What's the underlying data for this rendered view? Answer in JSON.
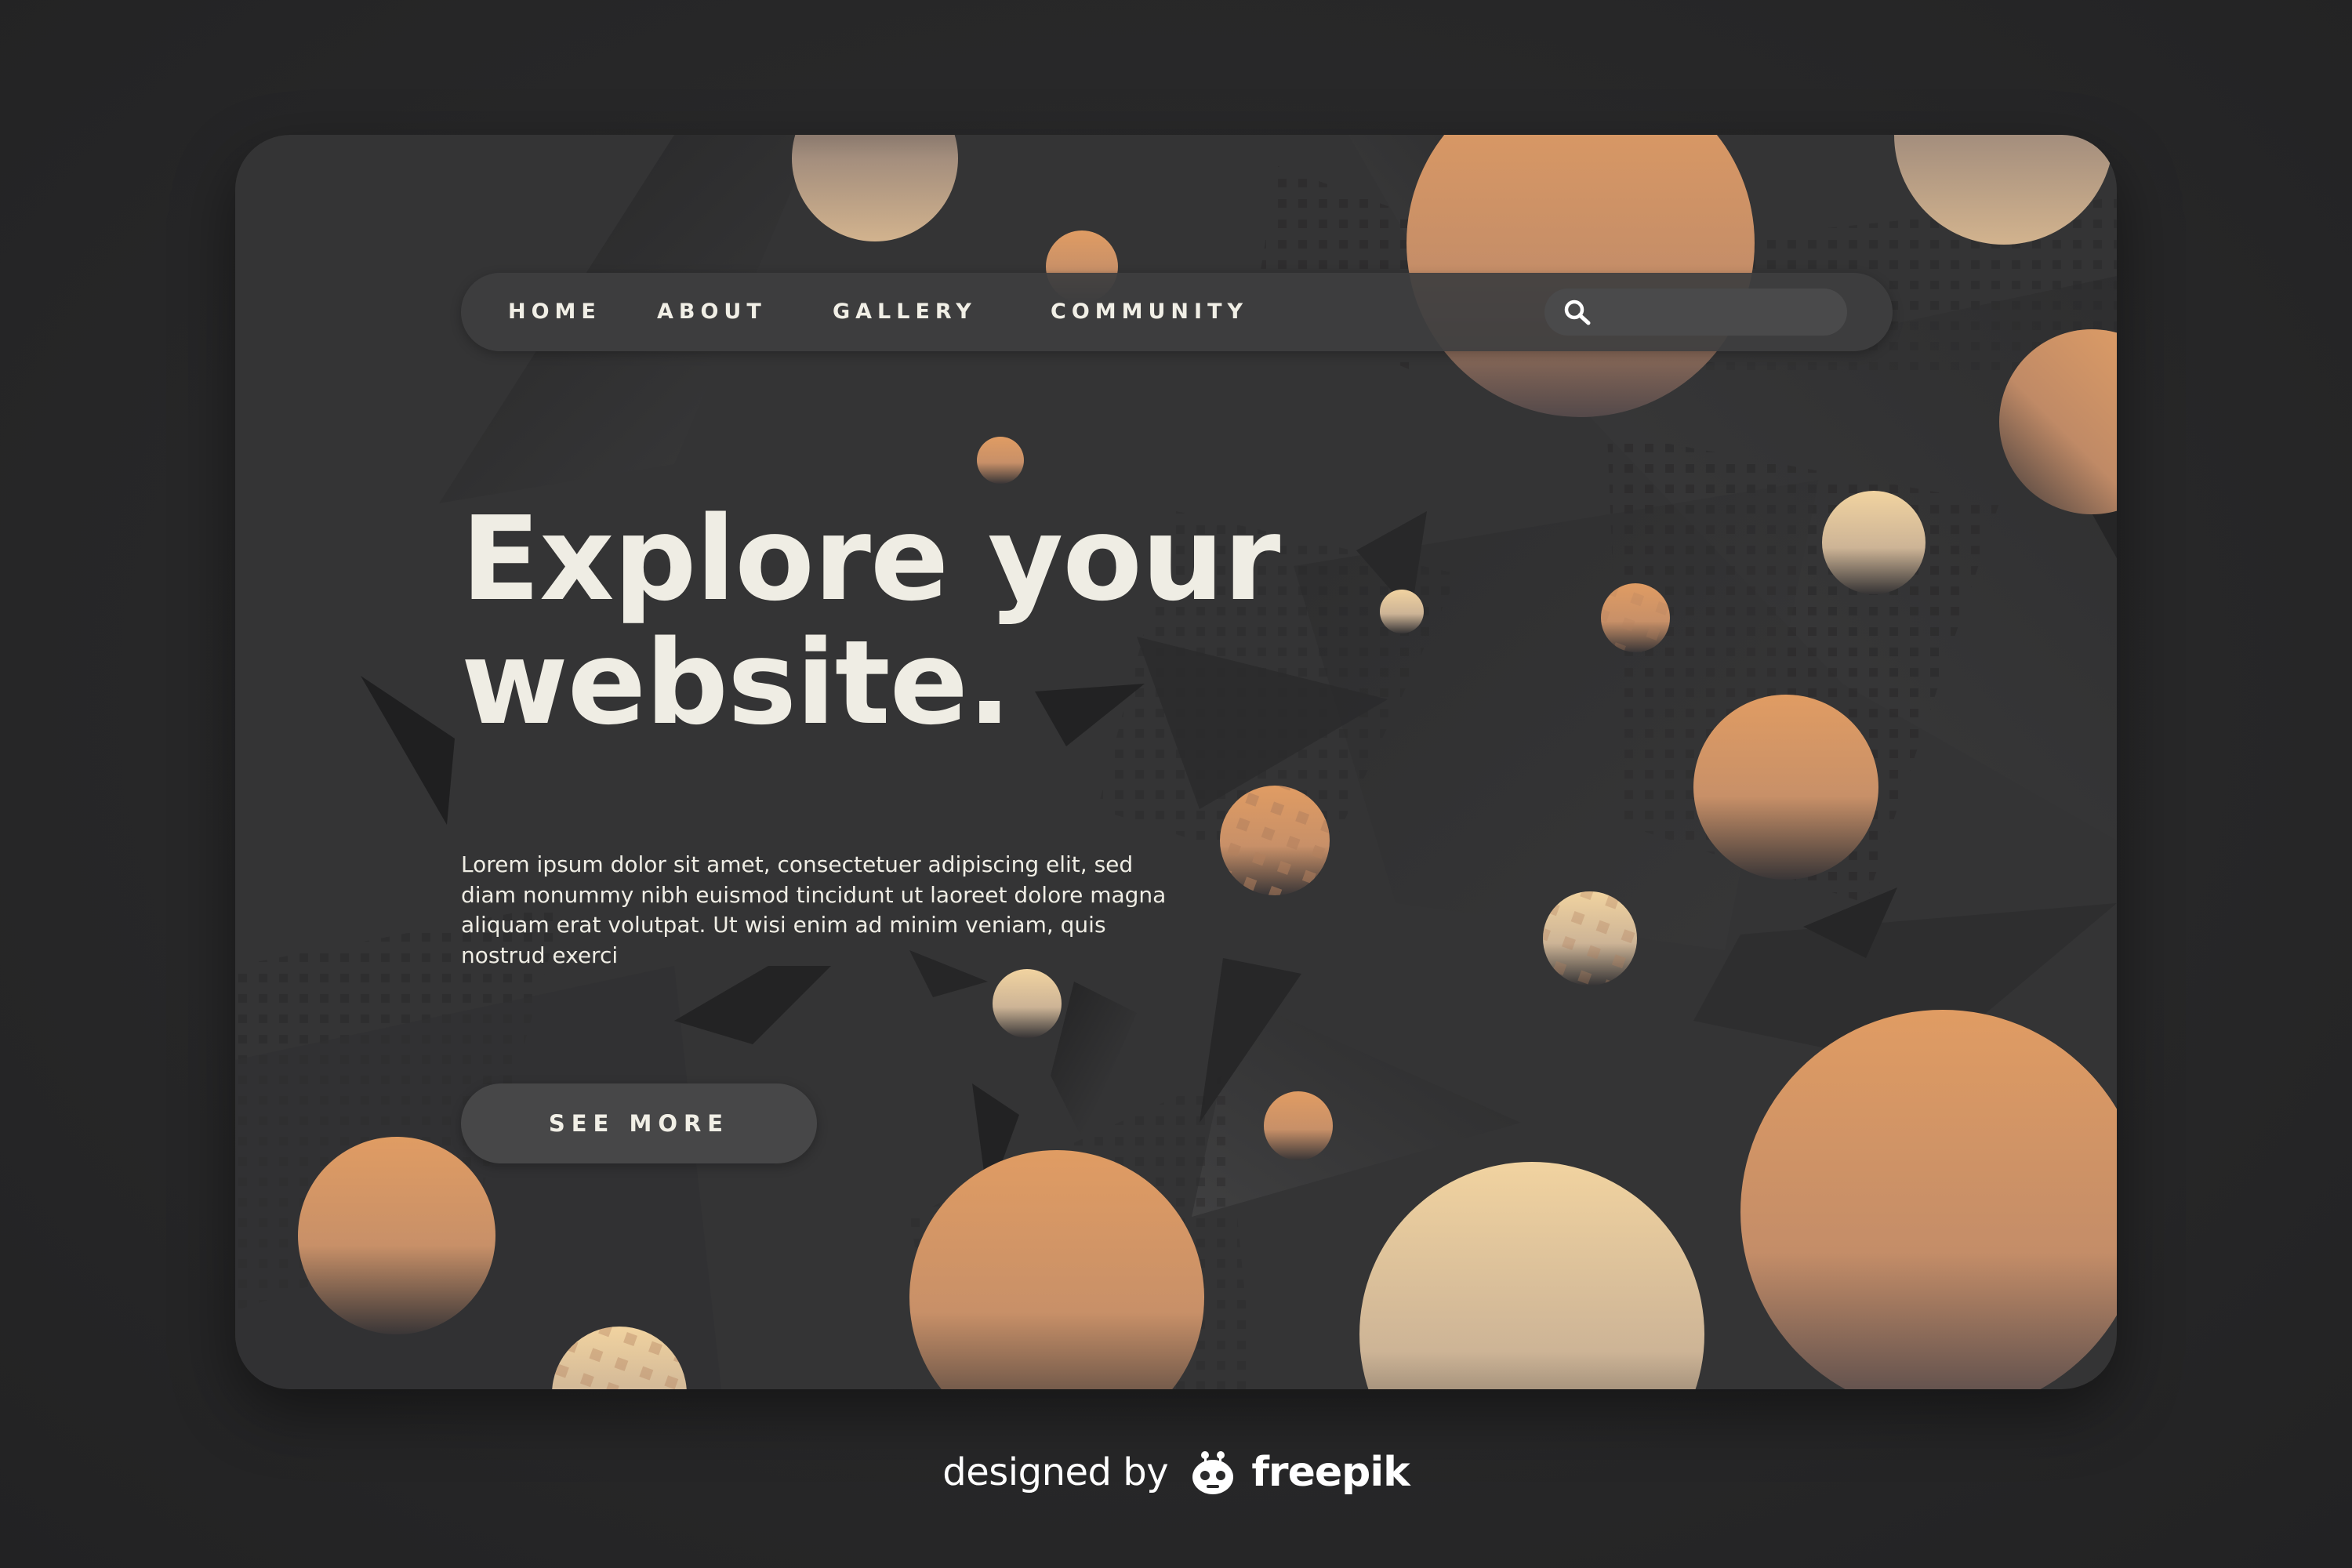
{
  "nav": {
    "items": [
      {
        "label": "HOME"
      },
      {
        "label": "ABOUT"
      },
      {
        "label": "GALLERY"
      },
      {
        "label": "COMMUNITY"
      }
    ],
    "search": {
      "placeholder": "",
      "icon": "search-icon"
    }
  },
  "hero": {
    "title_line1": "Explore your",
    "title_line2": "website.",
    "body": "Lorem ipsum dolor sit amet, consectetuer adipiscing elit, sed diam nonummy nibh euismod tincidunt ut laoreet dolore magna aliquam erat volutpat. Ut wisi enim ad minim veniam, quis nostrud exerci",
    "cta_label": "SEE MORE"
  },
  "footer": {
    "credit_prefix": "designed by",
    "credit_brand": "freepik",
    "logo_icon": "freepik-logo-icon"
  },
  "colors": {
    "page_background": "#2a2a2b",
    "card_background": "#343435",
    "text": "#efede4",
    "sphere_light": "#f0d2a2",
    "sphere_dark": "#2f2e31",
    "sphere_orange": "#e09c63"
  }
}
